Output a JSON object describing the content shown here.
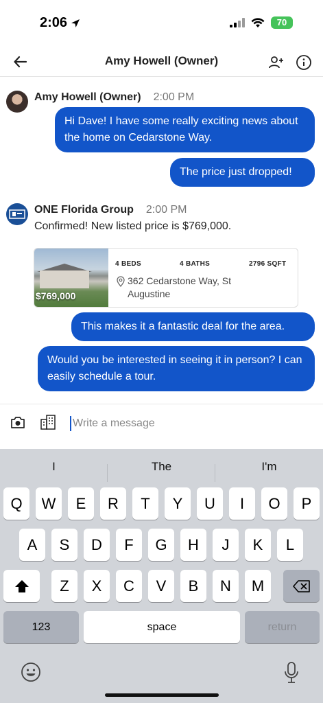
{
  "status": {
    "time": "2:06",
    "battery": "70"
  },
  "header": {
    "title": "Amy Howell (Owner)"
  },
  "messages": {
    "amy": {
      "sender": "Amy Howell (Owner)",
      "time": "2:00 PM",
      "bubble1": "Hi Dave! I have some really exciting news about the home on Cedarstone Way.",
      "bubble2": "The price just dropped!"
    },
    "group": {
      "sender": "ONE Florida Group",
      "time": "2:00 PM",
      "text": "Confirmed! New listed price is $769,000."
    },
    "listing": {
      "price": "$769,000",
      "beds": "4 BEDS",
      "baths": "4 BATHS",
      "sqft": "2796 SQFT",
      "address": "362 Cedarstone Way, St Augustine"
    },
    "bubble3": "This makes it a fantastic deal for the area.",
    "bubble4": "Would you be interested in seeing it in person? I can easily schedule a tour."
  },
  "composer": {
    "placeholder": "Write a message"
  },
  "keyboard": {
    "suggestions": [
      "I",
      "The",
      "I'm"
    ],
    "row1": [
      "Q",
      "W",
      "E",
      "R",
      "T",
      "Y",
      "U",
      "I",
      "O",
      "P"
    ],
    "row2": [
      "A",
      "S",
      "D",
      "F",
      "G",
      "H",
      "J",
      "K",
      "L"
    ],
    "row3": [
      "Z",
      "X",
      "C",
      "V",
      "B",
      "N",
      "M"
    ],
    "numbers_label": "123",
    "space_label": "space",
    "return_label": "return"
  },
  "colors": {
    "bubble": "#1255c9",
    "battery": "#45c35a",
    "keyboard_bg": "#d1d4d9"
  }
}
